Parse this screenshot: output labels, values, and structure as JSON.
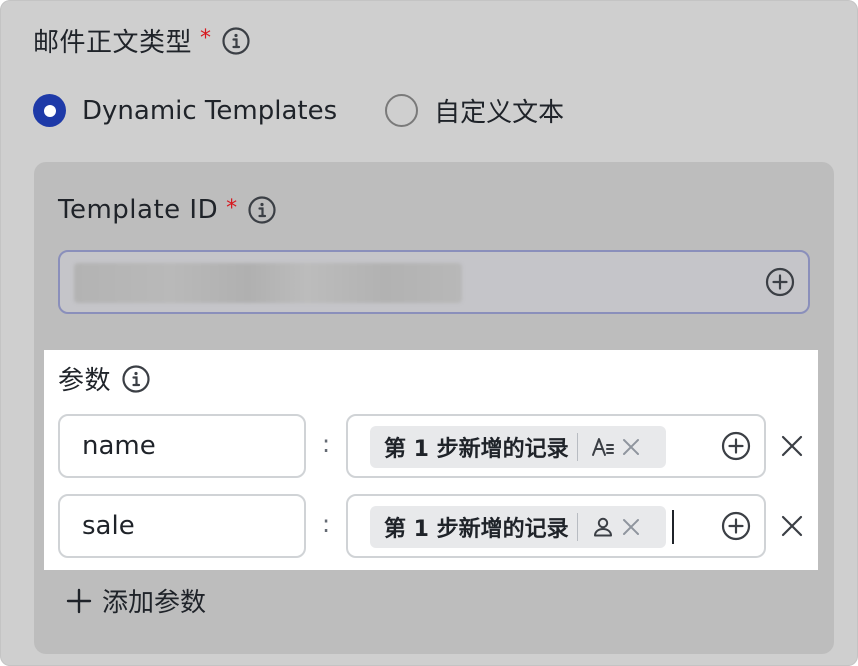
{
  "email_body_type": {
    "label": "邮件正文类型",
    "required_mark": "*",
    "options": [
      {
        "label": "Dynamic Templates",
        "selected": true
      },
      {
        "label": "自定义文本",
        "selected": false
      }
    ]
  },
  "template_id": {
    "label": "Template ID",
    "required_mark": "*",
    "value_redacted": true
  },
  "params": {
    "label": "参数",
    "rows": [
      {
        "key": "name",
        "separator": ":",
        "chip_text": "第 1 步新增的记录",
        "chip_icon": "text-field-icon"
      },
      {
        "key": "sale",
        "separator": ":",
        "chip_text": "第 1 步新增的记录",
        "chip_icon": "person-icon"
      }
    ],
    "add_label": "添加参数"
  },
  "colors": {
    "accent": "#1e3aa8",
    "required": "#d7191f",
    "overlay_bg": "#cfcfcf",
    "panel_bg": "#bdbdbd"
  }
}
